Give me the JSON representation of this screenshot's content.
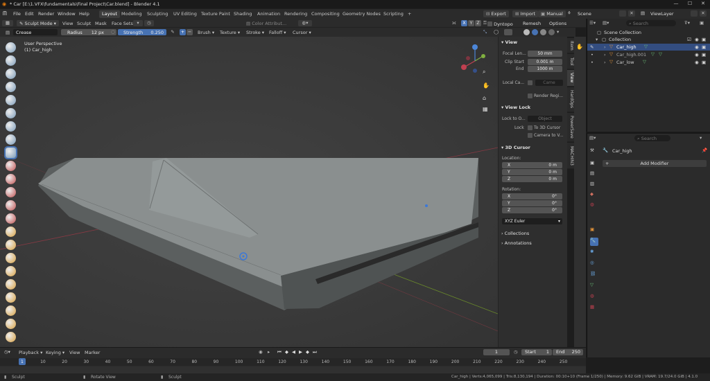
{
  "window": {
    "title": "* Car [E:\\1.VFX\\fundamentals\\Final Project\\Car.blend] - Blender 4.1"
  },
  "menu": [
    "File",
    "Edit",
    "Render",
    "Window",
    "Help"
  ],
  "workspaces": [
    "Layout",
    "Modeling",
    "Sculpting",
    "UV Editing",
    "Texture Paint",
    "Shading",
    "Animation",
    "Rendering",
    "Compositing",
    "Geometry Nodes",
    "Scripting"
  ],
  "top_right": {
    "export": "Export",
    "import": "Import",
    "manual": "Manual",
    "scene": "Scene",
    "viewlayer": "ViewLayer"
  },
  "mode_header": {
    "mode": "Sculpt Mode",
    "view": "View",
    "sculpt": "Sculpt",
    "mask": "Mask",
    "face_sets": "Face Sets",
    "color_attr": "Color Attribut...",
    "x": "X",
    "y": "Y",
    "z": "Z",
    "dyntopo": "Dyntopo",
    "remesh": "Remesh",
    "options": "Options"
  },
  "tool_header": {
    "brush_name": "Crease",
    "radius_label": "Radius",
    "radius_value": "12 px",
    "strength_label": "Strength",
    "strength_value": "0.250",
    "brush": "Brush",
    "texture": "Texture",
    "stroke": "Stroke",
    "falloff": "Falloff",
    "cursor": "Cursor"
  },
  "viewport": {
    "perspective": "User Perspective",
    "object": "(1) Car_high"
  },
  "npanel": {
    "view_header": "View",
    "focal_label": "Focal Len...",
    "focal_value": "50 mm",
    "clip_start_label": "Clip Start",
    "clip_start_value": "0.001 m",
    "end_label": "End",
    "end_value": "1000 m",
    "local_camera_label": "Local Ca...",
    "camera_placeholder": "Came",
    "render_region": "Render Regi...",
    "view_lock_header": "View Lock",
    "lock_to_label": "Lock to O...",
    "object_placeholder": "Object",
    "lock_label": "Lock",
    "to_3d_cursor": "To 3D Cursor",
    "camera_to_view": "Camera to V...",
    "cursor_header": "3D Cursor",
    "location_label": "Location:",
    "loc": [
      {
        "axis": "X",
        "value": "0 m"
      },
      {
        "axis": "Y",
        "value": "0 m"
      },
      {
        "axis": "Z",
        "value": "0 m"
      }
    ],
    "rotation_label": "Rotation:",
    "rot": [
      {
        "axis": "X",
        "value": "0°"
      },
      {
        "axis": "Y",
        "value": "0°"
      },
      {
        "axis": "Z",
        "value": "0°"
      }
    ],
    "rotation_mode": "XYZ Euler",
    "collections": "Collections",
    "annotations": "Annotations",
    "tabs": [
      "Item",
      "Tool",
      "View",
      "HardOps",
      "PowerSave",
      "MACHIN3"
    ]
  },
  "outliner": {
    "search_placeholder": "Search",
    "scene_collection": "Scene Collection",
    "collection": "Collection",
    "items": [
      "Car_high",
      "Car_high.001",
      "Car_low"
    ]
  },
  "properties": {
    "search_placeholder": "Search",
    "object_name": "Car_high",
    "add_modifier": "Add Modifier"
  },
  "timeline": {
    "playback": "Playback",
    "keying": "Keying",
    "view": "View",
    "marker": "Marker",
    "current_frame": "1",
    "start_label": "Start",
    "start_value": "1",
    "end_label": "End",
    "end_value": "250",
    "ticks": [
      "1",
      "10",
      "20",
      "30",
      "40",
      "50",
      "60",
      "70",
      "80",
      "90",
      "100",
      "110",
      "120",
      "130",
      "140",
      "150",
      "160",
      "170",
      "180",
      "190",
      "200",
      "210",
      "220",
      "230",
      "240",
      "250"
    ]
  },
  "status": {
    "left": "Sculpt",
    "middle": "Rotate View",
    "right_action": "Sculpt",
    "stats": "Car_high | Verts:4,065,099 | Tris:8,130,194 | Duration: 00:10+10 (Frame 1/250) | Memory: 9.62 GiB | VRAM: 19.7/24.0 GiB | 4.1.0"
  },
  "colors": {
    "accent": "#4772b3",
    "selected_row": "#334d80",
    "mesh": "#8a8f8f"
  }
}
